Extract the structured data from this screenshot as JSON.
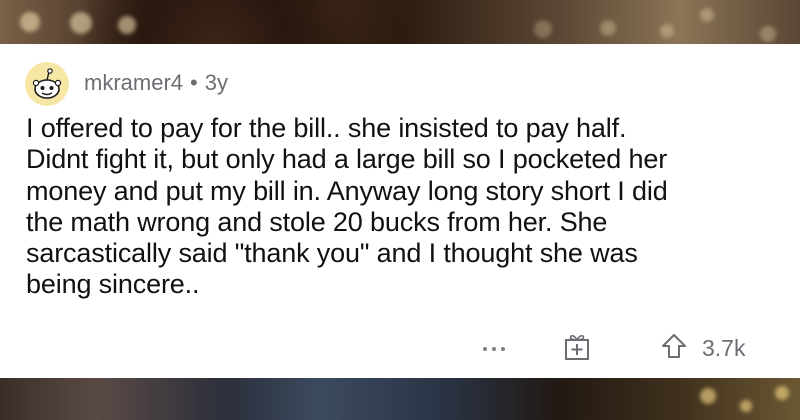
{
  "comment": {
    "username": "mkramer4",
    "separator": "•",
    "age": "3y",
    "lines": [
      "I offered to pay for the bill.. she insisted to pay half.",
      "Didnt fight it, but only had a large bill so I pocketed her",
      "money and put my bill in.  Anyway long story short I did",
      "the math wrong and stole 20 bucks from her.  She",
      "sarcastically said \"thank you\" and I thought she was",
      "being sincere.."
    ],
    "score": "3.7k"
  },
  "icons": {
    "avatar": "snoo-avatar-icon",
    "more": "more-options-icon",
    "award": "gift-icon",
    "upvote": "upvote-arrow-icon"
  },
  "colors": {
    "card_background": "#ffffff",
    "text": "#111111",
    "meta_text": "#6b6e73",
    "avatar_background": "#f6e7a6"
  }
}
